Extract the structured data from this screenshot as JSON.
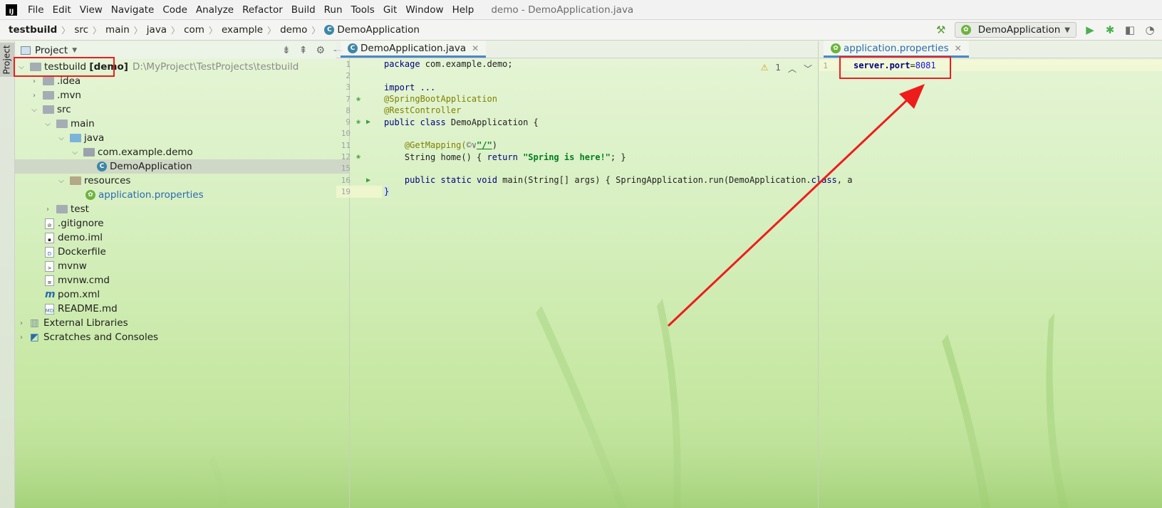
{
  "menubar": {
    "app_logo": "IJ",
    "items": [
      "File",
      "Edit",
      "View",
      "Navigate",
      "Code",
      "Analyze",
      "Refactor",
      "Build",
      "Run",
      "Tools",
      "Git",
      "Window",
      "Help"
    ],
    "window_title": "demo - DemoApplication.java"
  },
  "navbar": {
    "breadcrumbs": [
      "testbuild",
      "src",
      "main",
      "java",
      "com",
      "example",
      "demo",
      "DemoApplication"
    ],
    "run_config": "DemoApplication"
  },
  "left_strip": {
    "project_tab": "Project"
  },
  "project_panel": {
    "title": "Project",
    "tree": [
      {
        "label": "testbuild",
        "extra": "[demo]",
        "path": "D:\\MyProject\\TestProjects\\testbuild"
      },
      {
        "label": ".idea"
      },
      {
        "label": ".mvn"
      },
      {
        "label": "src"
      },
      {
        "label": "main"
      },
      {
        "label": "java"
      },
      {
        "label": "com.example.demo"
      },
      {
        "label": "DemoApplication"
      },
      {
        "label": "resources"
      },
      {
        "label": "application.properties"
      },
      {
        "label": "test"
      },
      {
        "label": ".gitignore"
      },
      {
        "label": "demo.iml"
      },
      {
        "label": "Dockerfile"
      },
      {
        "label": "mvnw"
      },
      {
        "label": "mvnw.cmd"
      },
      {
        "label": "pom.xml"
      },
      {
        "label": "README.md"
      },
      {
        "label": "External Libraries"
      },
      {
        "label": "Scratches and Consoles"
      }
    ]
  },
  "editor1": {
    "tab": "DemoApplication.java",
    "problems_count": "1",
    "lines": [
      {
        "n": "1"
      },
      {
        "n": "2"
      },
      {
        "n": "3"
      },
      {
        "n": "7"
      },
      {
        "n": "8"
      },
      {
        "n": "9"
      },
      {
        "n": "10"
      },
      {
        "n": "11"
      },
      {
        "n": "12"
      },
      {
        "n": "15"
      },
      {
        "n": "16"
      },
      {
        "n": "19"
      }
    ],
    "code": {
      "l1_kw": "package",
      "l1_rest": " com.example.demo;",
      "l3_kw": "import",
      "l3_rest": " ...",
      "l7": "@SpringBootApplication",
      "l8": "@RestController",
      "l9_kw": "public class",
      "l9_rest": " DemoApplication {",
      "l11_ann": "    @GetMapping(",
      "l11_icon": "©∨",
      "l11_str": "\"/\"",
      "l11_end": ")",
      "l12_a": "    String home() { ",
      "l12_kw": "return",
      "l12_str": " \"Spring is here!\"",
      "l12_end": "; }",
      "l16_kw": "    public static void",
      "l16_rest": " main(String[] args) { SpringApplication.run(DemoApplication.",
      "l16_kw2": "class",
      ", a": "",
      "l16_tail": ", a",
      "l19": "}"
    }
  },
  "editor2": {
    "tab": "application.properties",
    "line_no": "1",
    "key": "server.port",
    "eq": "=",
    "value": "8081"
  },
  "colors": {
    "highlight_box": "#ef1c1c",
    "accent": "#4a88c7"
  }
}
